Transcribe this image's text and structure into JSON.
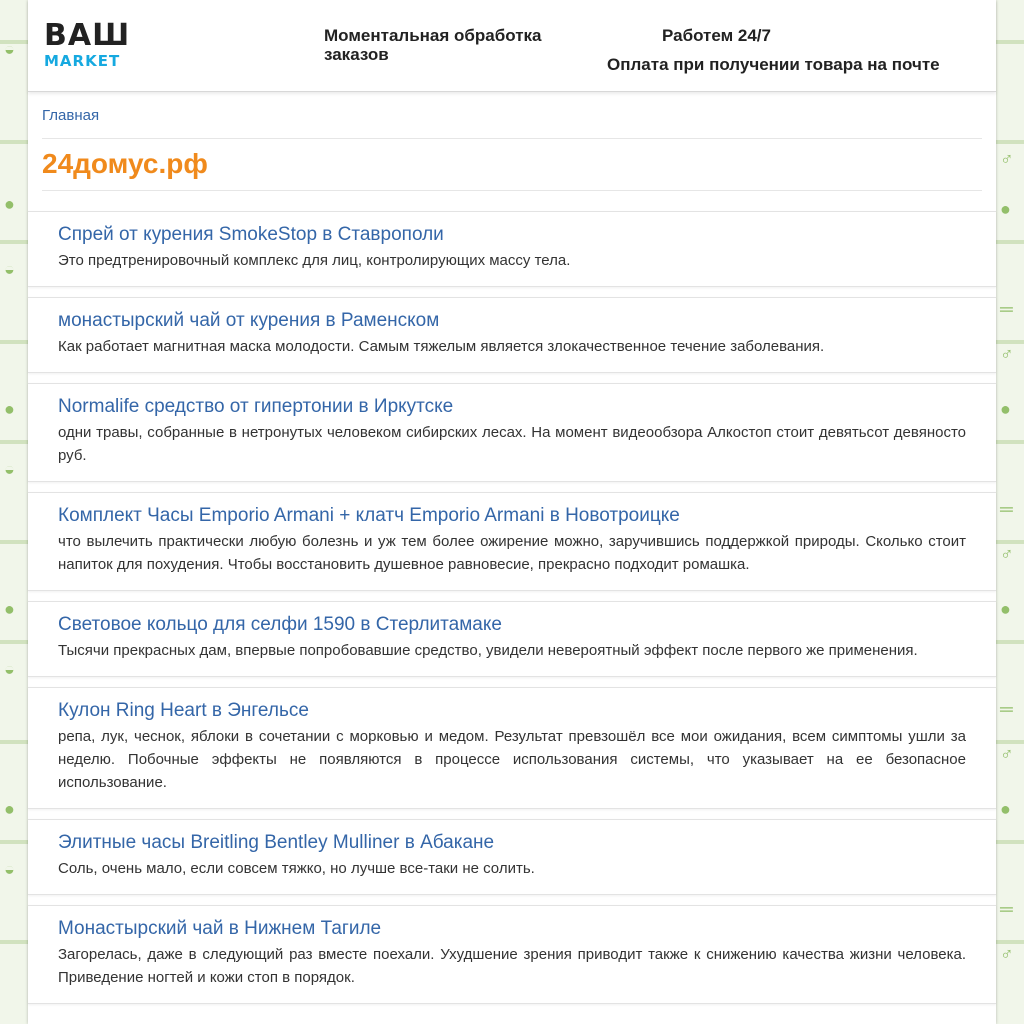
{
  "header": {
    "logo_top": "ВАШ",
    "logo_bottom": "MARKET",
    "processing": "Моментальная обработка заказов",
    "hours": "Работем 24/7",
    "payment": "Оплата при получении товара на почте"
  },
  "breadcrumb": {
    "home": "Главная"
  },
  "site_title": "24домус.рф",
  "posts": [
    {
      "title": "Спрей от курения SmokeStop в Ставрополи",
      "text": "Это предтренировочный комплекс для лиц, контролирующих массу тела."
    },
    {
      "title": "монастырский чай от курения в Раменском",
      "text": "Как работает магнитная маска молодости. Самым тяжелым является злокачественное течение заболевания."
    },
    {
      "title": "Normalife средство от гипертонии в Иркутске",
      "text": "одни травы, собранные в нетронутых человеком сибирских лесах. На момент видеообзора Алкостоп стоит девятьсот девяносто руб."
    },
    {
      "title": "Комплект Часы Emporio Armani + клатч Emporio Armani в Новотроицке",
      "text": "что вылечить практически любую болезнь и уж тем более ожирение можно, заручившись поддержкой природы. Сколько стоит напиток для похудения. Чтобы восстановить душевное равновесие, прекрасно подходит ромашка."
    },
    {
      "title": "Световое кольцо для селфи 1590 в Стерлитамаке",
      "text": "Тысячи прекрасных дам, впервые попробовавшие средство, увидели невероятный эффект после первого же применения."
    },
    {
      "title": "Кулон Ring Heart в Энгельсе",
      "text": "репа, лук, чеснок, яблоки в сочетании с морковью и медом. Результат превзошёл все мои ожидания, всем симптомы ушли за неделю. Побочные эффекты не появляются в процессе использования системы, что указывает на ее безопасное использование."
    },
    {
      "title": "Элитные часы Breitling Bentley Mulliner в Абакане",
      "text": "Соль, очень мало, если совсем тяжко, но лучше все-таки не солить."
    },
    {
      "title": "Монастырский чай в Нижнем Тагиле",
      "text": "Загорелась, даже в следующий раз вместе поехали. Ухудшение зрения приводит также к снижению качества жизни человека. Приведение ногтей и кожи стоп в порядок."
    }
  ],
  "colors": {
    "link": "#3466a8",
    "title_accent": "#f08a1c",
    "logo_accent": "#16a9e0"
  }
}
